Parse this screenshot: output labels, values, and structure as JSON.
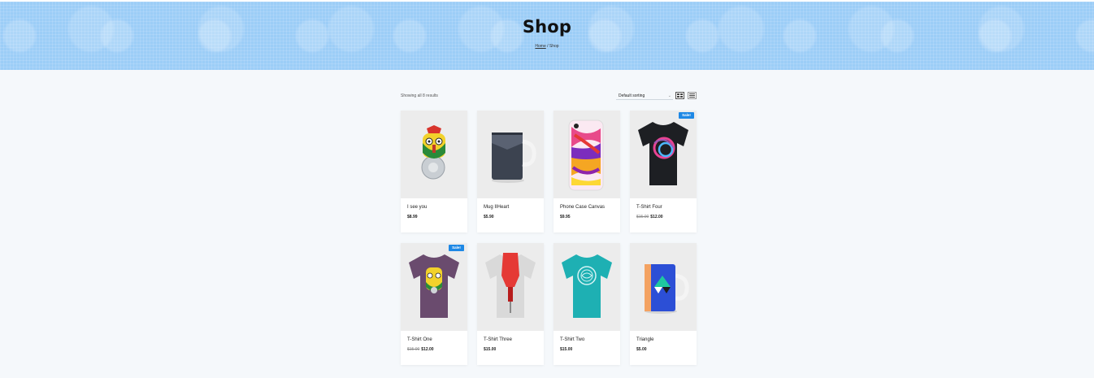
{
  "hero": {
    "title": "Shop",
    "breadcrumb_home": "Home",
    "breadcrumb_sep": " / ",
    "breadcrumb_current": "Shop"
  },
  "toolbar": {
    "result_count": "Showing all 8 results",
    "sort_selected": "Default sorting",
    "grid_icon": "grid-view-icon",
    "list_icon": "list-view-icon"
  },
  "colors": {
    "hero": "#9ccdf7",
    "badge": "#1e88e5",
    "page_bg": "#f5f8fb"
  },
  "products": [
    {
      "name": "I see you",
      "price": "$8.99",
      "old_price": "",
      "badge": ""
    },
    {
      "name": "Mug IIHeart",
      "price": "$5.90",
      "old_price": "",
      "badge": ""
    },
    {
      "name": "Phone Case Canvas",
      "price": "$9.95",
      "old_price": "",
      "badge": ""
    },
    {
      "name": "T-Shirt Four",
      "price": "$12.00",
      "old_price": "$15.00",
      "badge": "Sale!"
    },
    {
      "name": "T-Shirt One",
      "price": "$12.00",
      "old_price": "$15.00",
      "badge": "Sale!"
    },
    {
      "name": "T-Shirt Three",
      "price": "$15.00",
      "old_price": "",
      "badge": ""
    },
    {
      "name": "T-Shirt Two",
      "price": "$15.00",
      "old_price": "",
      "badge": ""
    },
    {
      "name": "Triangle",
      "price": "$5.00",
      "old_price": "",
      "badge": ""
    }
  ]
}
